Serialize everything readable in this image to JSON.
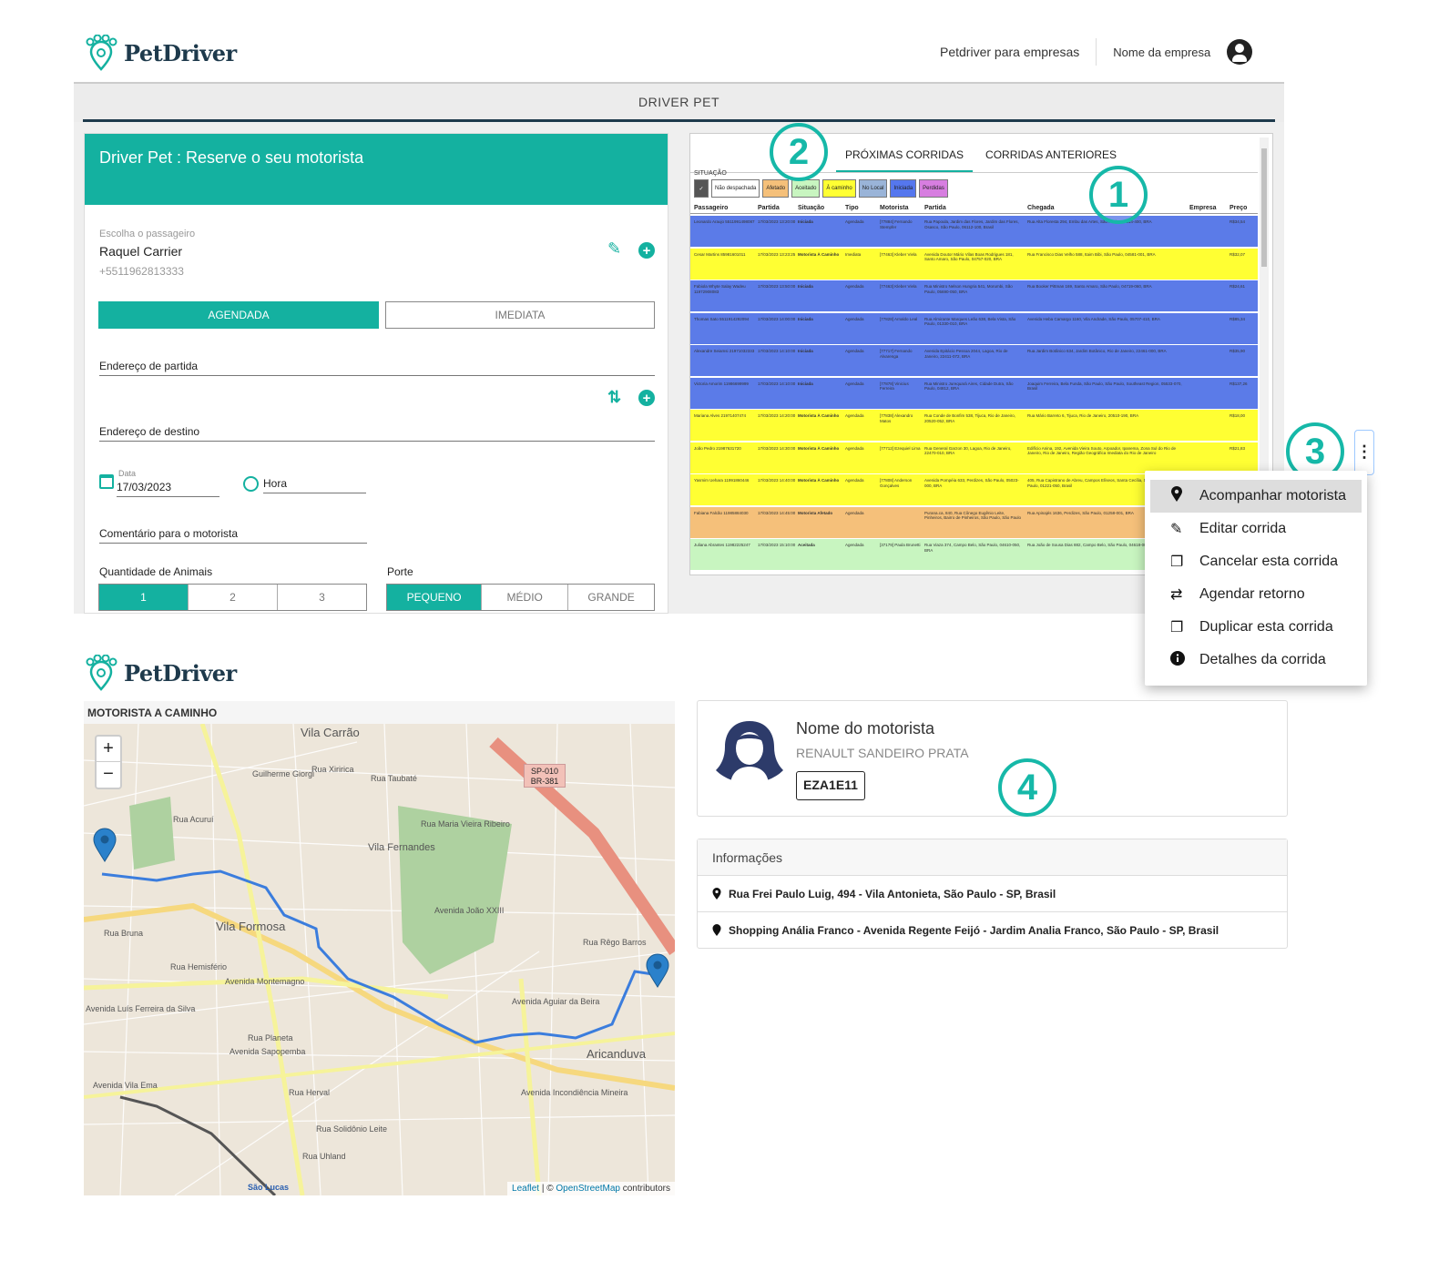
{
  "brand": {
    "name": "PetDriver"
  },
  "topnav": {
    "business_link": "Petdriver para empresas",
    "company_name": "Nome da empresa"
  },
  "appbar": {
    "title": "DRIVER PET"
  },
  "form": {
    "title": "Driver Pet : Reserve o seu motorista",
    "passenger_label": "Escolha o passageiro",
    "passenger_name": "Raquel Carrier",
    "passenger_phone": "+5511962813333",
    "mode_scheduled": "AGENDADA",
    "mode_immediate": "IMEDIATA",
    "origin_label": "Endereço de partida",
    "destination_label": "Endereço de destino",
    "date_label": "Data",
    "date_value": "17/03/2023",
    "time_label": "Hora",
    "comment_label": "Comentário para o motorista",
    "animals_label": "Quantidade de Animais",
    "animals_options": [
      "1",
      "2",
      "3"
    ],
    "size_label": "Porte",
    "size_options": [
      "PEQUENO",
      "MÉDIO",
      "GRANDE"
    ]
  },
  "table": {
    "tabs": [
      "PRÓXIMAS CORRIDAS",
      "CORRIDAS ANTERIORES"
    ],
    "situation_label": "SITUAÇÃO",
    "filters": [
      {
        "label": "✓",
        "color": "#555555"
      },
      {
        "label": "Não despachada",
        "color": "#ffffff"
      },
      {
        "label": "Afetado",
        "color": "#f5c07a"
      },
      {
        "label": "Aceitado",
        "color": "#c8f5c0"
      },
      {
        "label": "À caminho",
        "color": "#ffff33"
      },
      {
        "label": "No Local",
        "color": "#9ab4d8"
      },
      {
        "label": "Iniciada",
        "color": "#5577ee"
      },
      {
        "label": "Perdidas",
        "color": "#d77ee0"
      }
    ],
    "columns": [
      "Passageiro",
      "Partida",
      "Situação",
      "Tipo",
      "Motorista",
      "Partida",
      "Chegada",
      "Empresa",
      "Preço"
    ],
    "rows": [
      {
        "color": "#5b7be8",
        "cells": [
          "Leonardo Araujo 5511991498087",
          "17/03/2023 13:20:00",
          "Iniciada",
          "Agendada",
          "[77884] Fernando Stempfer",
          "Rua Papoula, Jardim das Flores, Jardim das Flores, Osasco, São Paulo, 06112-100, Brasil",
          "Rua Alta Floresta 294, Embu das Artes, São Paulo, 06814-400, BRA",
          "",
          "R$34,54"
        ]
      },
      {
        "color": "#ffff33",
        "cells": [
          "Cesar Martins 85981601011",
          "17/03/2023 13:23:25",
          "Motorista À Caminho",
          "Imediata",
          "[77463] Kleber Viela",
          "Avenida Doutor Mário Vilas Boas Rodrigues 181, Santo Amaro, São Paulo, 04757-020, BRA",
          "Rua Francisco Dias Velho 588, Itaim Bibi, São Paulo, 04581-001, BRA",
          "",
          "R$32,07"
        ]
      },
      {
        "color": "#5b7be8",
        "cells": [
          "Fabiola Whyte Salay Wadeu 11972908083",
          "17/03/2023 13:50:00",
          "Iniciada",
          "Agendada",
          "[77463] Kleber Viela",
          "Rua Ministro Nelson Hungria 541, Morumbi, São Paulo, 05690-050, BRA",
          "Rua Booker Pittman 169, Santo Amaro, São Paulo, 04719-060, BRA",
          "",
          "R$24,61"
        ]
      },
      {
        "color": "#5b7be8",
        "cells": [
          "Thomas Sato 5511914292094",
          "17/03/2023 14:00:00",
          "Iniciada",
          "Agendada",
          "[77828] Arnaldo Leal",
          "Rua Almirante Marques Leão 638, Bela Vista, São Paulo, 01330-010, BRA",
          "Avenida Heba Camargo 1160, Vila Andrade, São Paulo, 05707-410, BRA",
          "",
          "R$85,34"
        ]
      },
      {
        "color": "#5b7be8",
        "cells": [
          "Alexandre Seiamsi 21971032333",
          "17/03/2023 14:10:00",
          "Iniciada",
          "Agendada",
          "[77717] Fernando Alvarenga",
          "Avenida Epitácio Pessoa 2044, Lagoa, Rio de Janeiro, 22411-072, BRA",
          "Rua Jardim Botânico 634, Jardim Botânico, Rio de Janeiro, 22461-000, BRA",
          "",
          "R$35,90"
        ]
      },
      {
        "color": "#5b7be8",
        "cells": [
          "Victoria Amorim 11986699999",
          "17/03/2023 14:10:00",
          "Iniciada",
          "Agendada",
          "[77878] Vinicius Ferreira",
          "Rua Ministro Jurequará Aires, Cidade Dutra, São Paulo, 04812, BRA",
          "Joaquim Ferreira, Bela Funda, São Paulo, São Paulo, Southeast Region, 05533-070, Brasil",
          "",
          "R$137,26"
        ]
      },
      {
        "color": "#ffff33",
        "cells": [
          "Mariana Alves 21971407474",
          "17/03/2023 14:20:00",
          "Motorista À Caminho",
          "Agendada",
          "[77838] Alexandro Matos",
          "Rua Conde de Bonfim 538, Tijuca, Rio de Janeiro, 20520-052, BRA",
          "Rua Mário Barreto 6, Tijuca, Rio de Janeiro, 20510-190, BRA",
          "",
          "R$18,00"
        ]
      },
      {
        "color": "#ffff33",
        "cells": [
          "João Pedro 21987631720",
          "17/03/2023 14:30:00",
          "Motorista À Caminho",
          "Agendada",
          "[77712] Ezequiel Lima",
          "Rua General Garzon 30, Lagoa, Rio de Janeiro, 22470-010, BRA",
          "Edifício Anina, 192, Avenida Vieira Souto, Arpoador, Ipanema, Zona Sul do Rio de Janeiro, Rio de Janeiro, Região Geográfica Imediata do Rio de Janeiro",
          "",
          "R$21,83"
        ]
      },
      {
        "color": "#ffff33",
        "cells": [
          "Yasmim Uehara 11991860446",
          "17/03/2023 14:40:00",
          "Motorista À Caminho",
          "Agendada",
          "[77808] Anderson Gonçalves",
          "Avenida Pompéia 633, Perdizes, São Paulo, 05023-000, BRA",
          "405, Rua Capistrano de Abreu, Campos Elíseos, Santa Cecília, São Paulo, São Paulo, 01221-050, Brasil",
          "",
          ""
        ]
      },
      {
        "color": "#f5c07a",
        "cells": [
          "Fabiana Falcão 11985884030",
          "17/03/2023 14:45:00",
          "Motorista Afetado",
          "Agendada",
          "",
          "Purana.ca, 840, Rua Cônego Eugênio Leite, Pinheiros, Bairro de Pinheiros, São Paulo, São Paulo",
          "Rua Apinajés 1636, Perdizes, São Paulo, 01258-001, BRA",
          "",
          ""
        ]
      },
      {
        "color": "#c8f5c0",
        "cells": [
          "Juliana Abrantes 11982225247",
          "17/03/2023 15:10:00",
          "Aceitada",
          "Agendada",
          "[37179] Paula Brunetti",
          "Rua Viaza 374, Campo Belo, São Paulo, 04610-050, BRA",
          "Rua João de Sousa Dias 882, Campo Belo, São Paulo, 04618-003, BRA",
          "",
          ""
        ]
      }
    ]
  },
  "badges": {
    "b1": "1",
    "b2": "2",
    "b3": "3",
    "b4": "4"
  },
  "menu": {
    "items": [
      {
        "label": "Acompanhar motorista",
        "icon": "map-pin-icon"
      },
      {
        "label": "Editar corrida",
        "icon": "pencil-icon"
      },
      {
        "label": "Cancelar esta corrida",
        "icon": "copy-icon"
      },
      {
        "label": "Agendar retorno",
        "icon": "swap-icon"
      },
      {
        "label": "Duplicar esta corrida",
        "icon": "copy-icon"
      },
      {
        "label": "Detalhes da corrida",
        "icon": "info-icon"
      }
    ]
  },
  "map": {
    "title": "MOTORISTA A CAMINHO",
    "zoom_in": "+",
    "zoom_out": "−",
    "attribution_leaflet": "Leaflet",
    "attribution_sep": " | © ",
    "attribution_osm": "OpenStreetMap",
    "attribution_tail": " contributors",
    "labels": [
      "Vila Carrão",
      "Vila Fernandes",
      "Vila Formosa",
      "Aricanduva",
      "Rua Xiririca",
      "Rua Taubaté",
      "Avenida Montemagno",
      "Avenida Sapopemba",
      "Rua Planeta",
      "Avenida Vila Ema",
      "São Lucas",
      "Rua Solidônio Leite",
      "Avenida Aguiar da Beira",
      "Rua Rêgo Barros",
      "SP-010",
      "BR-381",
      "Rua Hemisfério",
      "Avenida Luís Ferreira da Silva",
      "Rua Acuruí",
      "Rua Bruna",
      "Rua Herval",
      "Rua Uhland",
      "Avenida João XXIII",
      "Rua Maria Vieira Ribeiro",
      "Guilherme Giorgi",
      "Avenida Incondiência Mineira"
    ]
  },
  "driver": {
    "name": "Nome do motorista",
    "vehicle": "RENAULT SANDEIRO PRATA",
    "plate": "EZA1E11"
  },
  "info": {
    "title": "Informações",
    "origin": "Rua Frei Paulo Luig, 494 - Vila Antonieta, São Paulo - SP, Brasil",
    "destination": "Shopping Anália Franco - Avenida Regente Feijó - Jardim Analia Franco, São Paulo - SP, Brasil"
  }
}
